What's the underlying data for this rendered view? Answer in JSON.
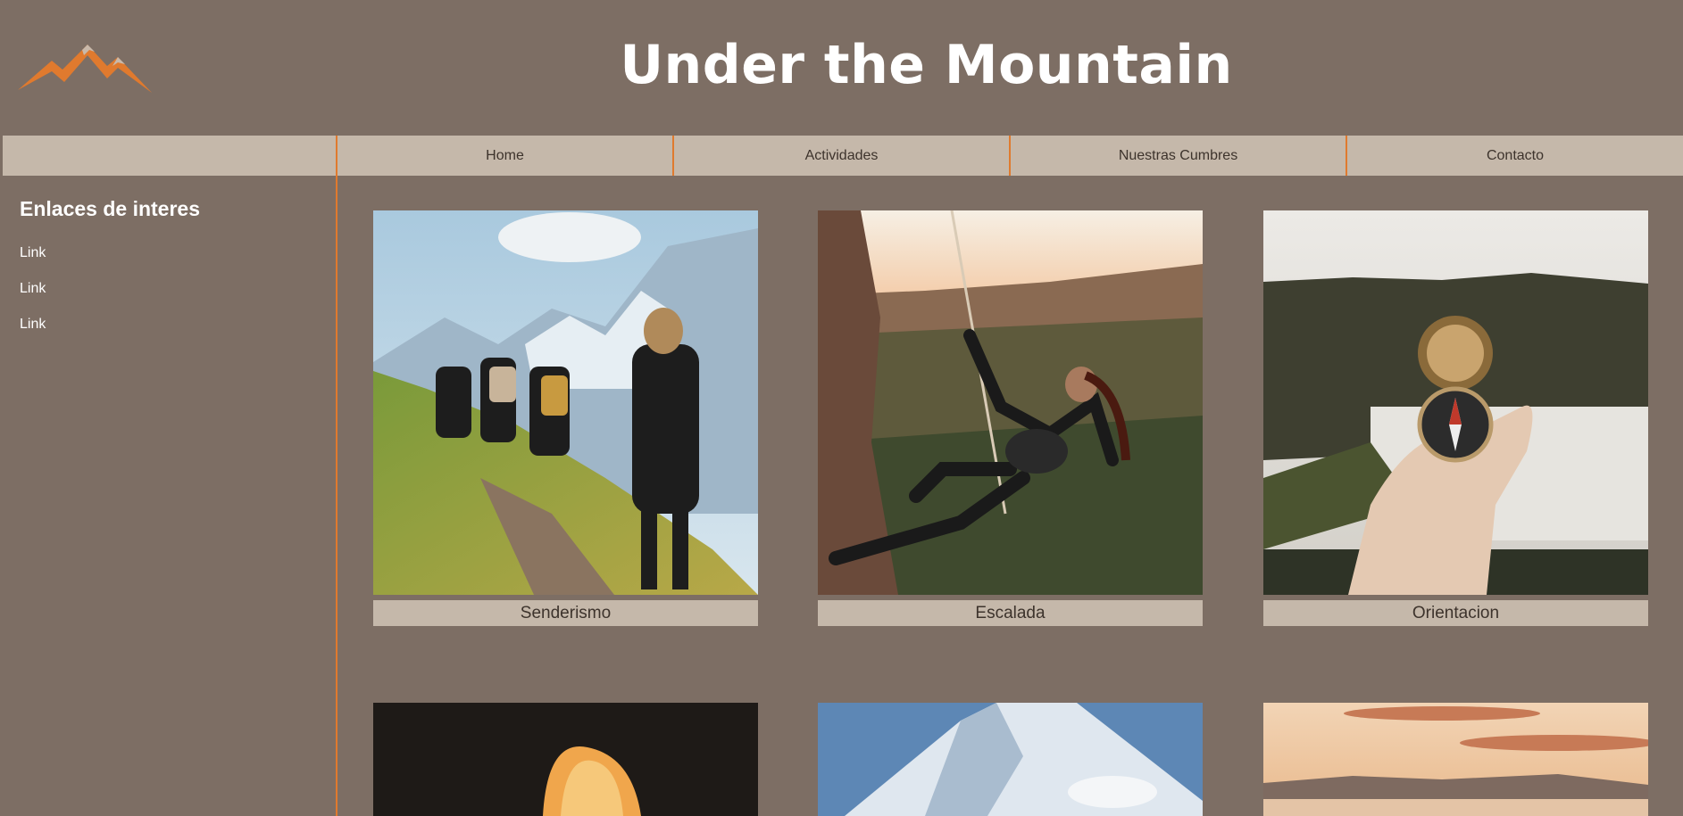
{
  "header": {
    "title": "Under the Mountain",
    "logo_icon": "mountain-logo-icon"
  },
  "nav": {
    "items": [
      "Home",
      "Actividades",
      "Nuestras Cumbres",
      "Contacto"
    ]
  },
  "sidebar": {
    "heading": "Enlaces de interes",
    "links": [
      "Link",
      "Link",
      "Link"
    ]
  },
  "cards": [
    {
      "label": "Senderismo"
    },
    {
      "label": "Escalada"
    },
    {
      "label": "Orientacion"
    },
    {
      "label": ""
    },
    {
      "label": ""
    },
    {
      "label": ""
    }
  ],
  "colors": {
    "background": "#7d6e64",
    "nav_bg": "#c5b8aa",
    "accent": "#e07a2e",
    "text_dark": "#3d332c"
  }
}
